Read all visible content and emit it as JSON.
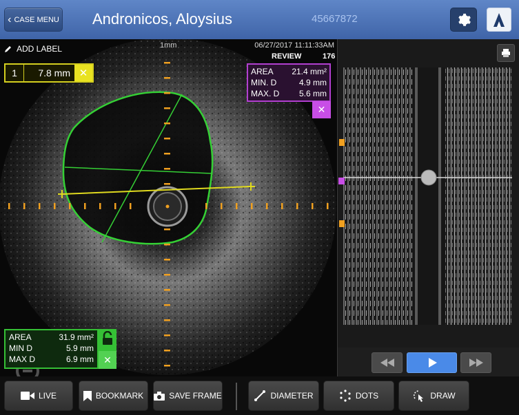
{
  "header": {
    "case_menu_label": "CASE MENU",
    "patient_name": "Andronicos, Aloysius",
    "patient_id": "45667872"
  },
  "image": {
    "add_label": "ADD LABEL",
    "scale_label": "1mm",
    "date_time": "06/27/2017  11:11:33AM",
    "mode": "REVIEW",
    "frame_number": "176"
  },
  "measurements": {
    "diameter": {
      "index": "1",
      "value": "7.8 mm",
      "color": "#d4cf1f"
    },
    "inner": {
      "area_label": "AREA",
      "area_value": "21.4 mm²",
      "min_label": "MIN. D",
      "min_value": "4.9 mm",
      "max_label": "MAX. D",
      "max_value": "5.6 mm",
      "color": "#b23fd0"
    },
    "outer": {
      "area_label": "AREA",
      "area_value": "31.9 mm²",
      "min_label": "MIN D",
      "min_value": "5.9 mm",
      "max_label": "MAX D",
      "max_value": "6.9 mm",
      "color": "#35c035"
    }
  },
  "toolbar": {
    "live": "LIVE",
    "bookmark": "BOOKMARK",
    "save_frame": "SAVE FRAME",
    "diameter": "DIAMETER",
    "dots": "DOTS",
    "draw": "DRAW"
  },
  "icons": [
    "gear-icon",
    "logo-icon",
    "pencil-icon",
    "print-icon",
    "rewind-icon",
    "play-icon",
    "fast-forward-icon",
    "camera-icon",
    "bookmark-icon",
    "video-icon",
    "diameter-icon",
    "dots-icon",
    "draw-icon",
    "zoom-icon",
    "lock-icon",
    "close-icon"
  ],
  "colors": {
    "accent": "#4a7fe0",
    "topbar": "#4f76b8"
  }
}
